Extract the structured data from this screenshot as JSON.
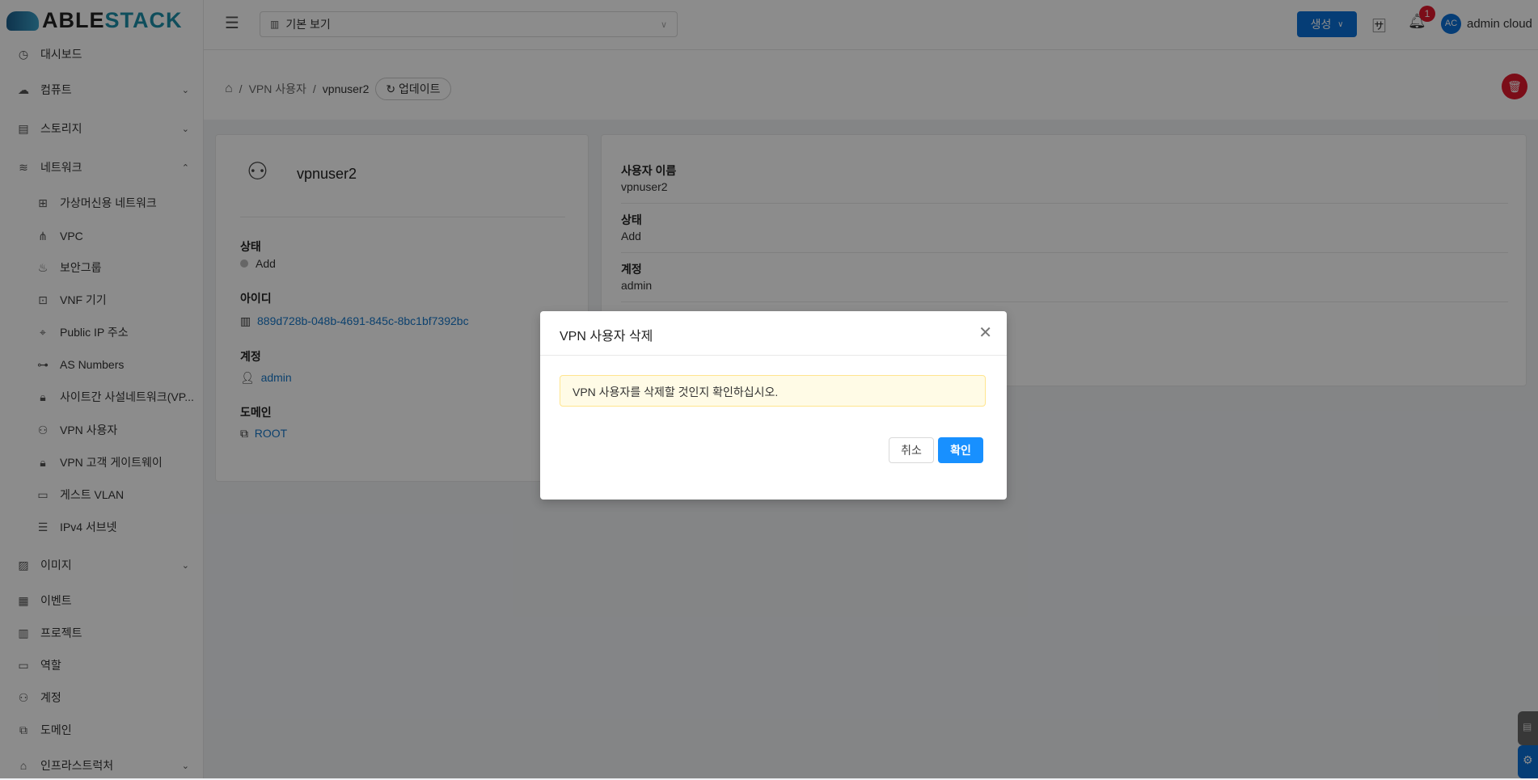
{
  "app": {
    "logo_part1": "ABLE",
    "logo_part2": "STACK"
  },
  "header": {
    "view_select": "기본 보기",
    "create_label": "생성",
    "notification_count": "1",
    "avatar_initials": "AC",
    "user_name": "admin cloud"
  },
  "sidebar": {
    "items": [
      {
        "label": "대시보드",
        "icon": "dashboard-icon",
        "level": "top"
      },
      {
        "label": "컴퓨트",
        "icon": "cloud-icon",
        "level": "top",
        "chevron": "⌄"
      },
      {
        "label": "스토리지",
        "icon": "storage-icon",
        "level": "top",
        "chevron": "⌄"
      },
      {
        "label": "네트워크",
        "icon": "wifi-icon",
        "level": "top",
        "chevron": "⌃"
      },
      {
        "label": "가상머신용 네트워크",
        "icon": "network-icon",
        "level": "sub"
      },
      {
        "label": "VPC",
        "icon": "vpc-icon",
        "level": "sub"
      },
      {
        "label": "보안그룹",
        "icon": "fire-icon",
        "level": "sub"
      },
      {
        "label": "VNF 기기",
        "icon": "vnf-icon",
        "level": "sub"
      },
      {
        "label": "Public IP 주소",
        "icon": "location-icon",
        "level": "sub"
      },
      {
        "label": "AS Numbers",
        "icon": "cluster-icon",
        "level": "sub"
      },
      {
        "label": "사이트간 사설네트워크(VP...",
        "icon": "lock-icon",
        "level": "sub"
      },
      {
        "label": "VPN 사용자",
        "icon": "user-switch-icon",
        "level": "sub"
      },
      {
        "label": "VPN 고객 게이트웨이",
        "icon": "lock-icon",
        "level": "sub"
      },
      {
        "label": "게스트 VLAN",
        "icon": "folder-icon",
        "level": "sub"
      },
      {
        "label": "IPv4 서브넷",
        "icon": "subnet-icon",
        "level": "sub"
      },
      {
        "label": "이미지",
        "icon": "picture-icon",
        "level": "top",
        "chevron": "⌄"
      },
      {
        "label": "이벤트",
        "icon": "calendar-icon",
        "level": "top"
      },
      {
        "label": "프로젝트",
        "icon": "project-icon",
        "level": "top"
      },
      {
        "label": "역할",
        "icon": "idcard-icon",
        "level": "top"
      },
      {
        "label": "계정",
        "icon": "team-icon",
        "level": "top"
      },
      {
        "label": "도메인",
        "icon": "block-icon",
        "level": "top"
      },
      {
        "label": "인프라스트럭처",
        "icon": "bank-icon",
        "level": "top",
        "chevron": "⌄"
      }
    ]
  },
  "breadcrumb": {
    "items": [
      "VPN 사용자",
      "vpnuser2"
    ],
    "refresh_label": "업데이트"
  },
  "details": {
    "name": "vpnuser2",
    "state_label": "상태",
    "state_value": "Add",
    "id_label": "아이디",
    "id_value": "889d728b-048b-4691-845c-8bc1bf7392bc",
    "account_label": "계정",
    "account_value": "admin",
    "domain_label": "도메인",
    "domain_value": "ROOT"
  },
  "info": {
    "rows": [
      {
        "label": "사용자 이름",
        "value": "vpnuser2"
      },
      {
        "label": "상태",
        "value": "Add"
      },
      {
        "label": "계정",
        "value": "admin"
      }
    ]
  },
  "modal": {
    "title": "VPN 사용자 삭제",
    "message": "VPN 사용자를 삭제할 것인지 확인하십시오.",
    "cancel_label": "취소",
    "ok_label": "확인"
  },
  "colors": {
    "primary": "#1890ff",
    "danger": "#e0182d",
    "alert_bg": "#fffbe6",
    "alert_border": "#ffe58f"
  }
}
